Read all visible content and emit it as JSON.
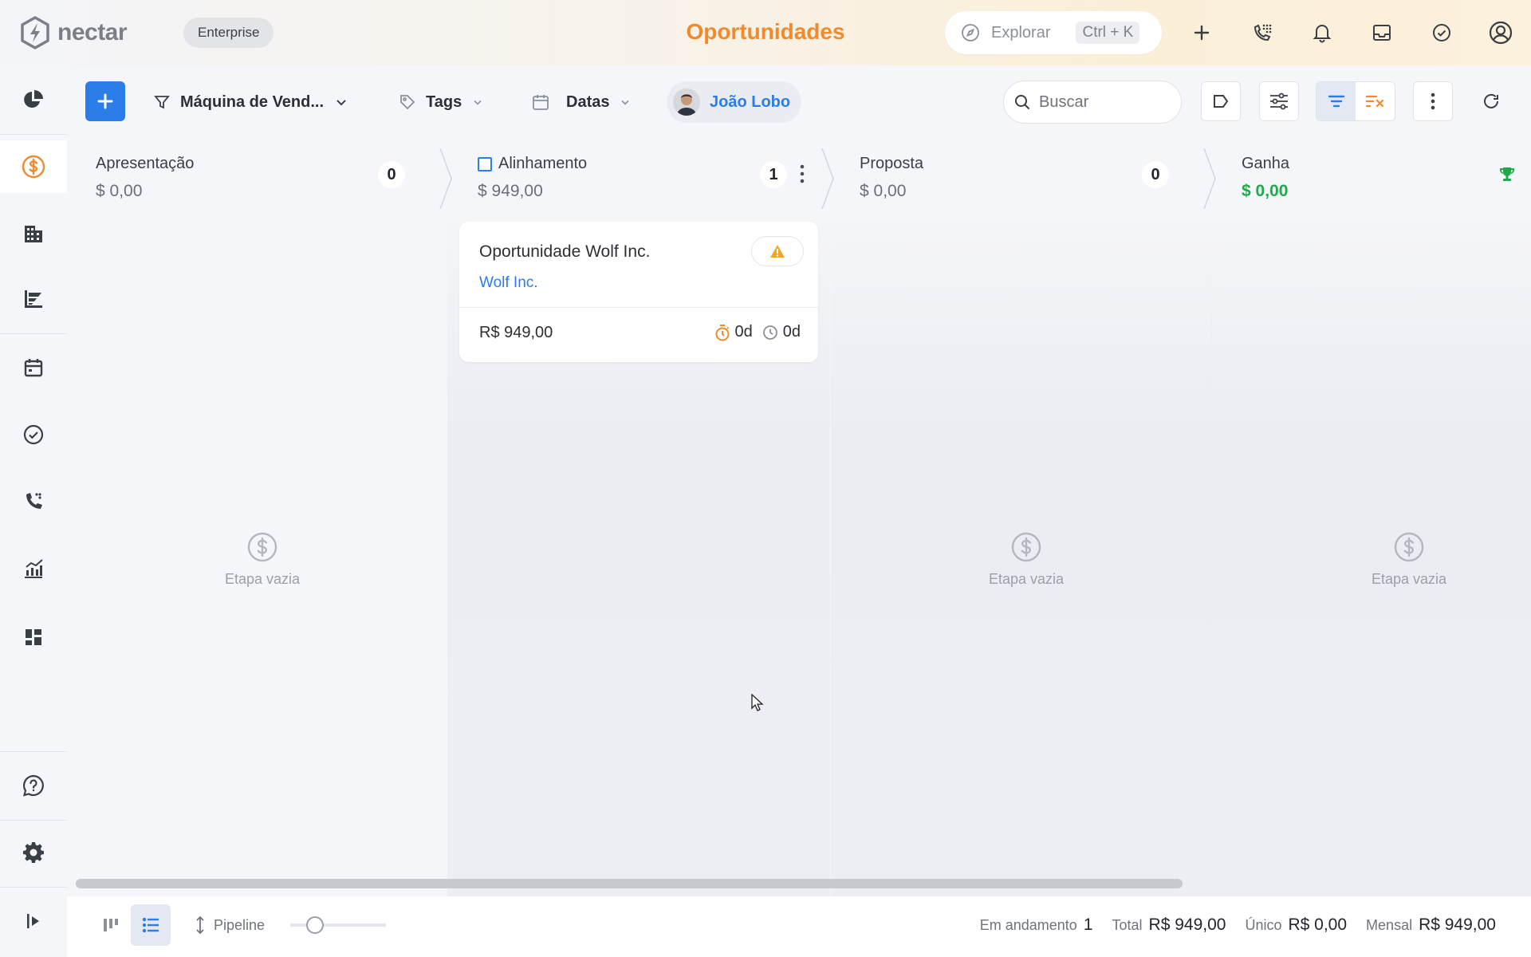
{
  "brand": {
    "name": "nectar",
    "plan": "Enterprise"
  },
  "page_title": "Oportunidades",
  "explore": {
    "label": "Explorar",
    "shortcut": "Ctrl + K"
  },
  "top_icons": [
    "plus-icon",
    "phone-dialpad-icon",
    "bell-icon",
    "inbox-icon",
    "check-circle-icon",
    "user-circle-icon"
  ],
  "sidebar": {
    "items": [
      {
        "name": "dashboard",
        "icon": "pie-chart-icon"
      },
      {
        "name": "opportunities",
        "icon": "dollar-circle-icon",
        "active": true
      },
      {
        "name": "companies",
        "icon": "building-icon"
      },
      {
        "name": "funnel",
        "icon": "funnel-chart-icon"
      },
      {
        "name": "calendar",
        "icon": "calendar-icon"
      },
      {
        "name": "tasks",
        "icon": "check-circle-icon"
      },
      {
        "name": "calls",
        "icon": "phone-icon"
      },
      {
        "name": "reports",
        "icon": "line-chart-icon"
      },
      {
        "name": "widgets",
        "icon": "dashboard-tiles-icon"
      },
      {
        "name": "help",
        "icon": "help-bubble-icon"
      },
      {
        "name": "settings",
        "icon": "gear-icon"
      },
      {
        "name": "expand",
        "icon": "expand-sidebar-icon"
      }
    ]
  },
  "toolbar": {
    "pipeline": "Máquina de Vend...",
    "tags": "Tags",
    "dates": "Datas",
    "owner": "João Lobo",
    "search_placeholder": "Buscar"
  },
  "stages": [
    {
      "name": "Apresentação",
      "value": "$ 0,00",
      "count": "0",
      "empty_label": "Etapa vazia"
    },
    {
      "name": "Alinhamento",
      "value": "$ 949,00",
      "count": "1"
    },
    {
      "name": "Proposta",
      "value": "$ 0,00",
      "count": "0",
      "empty_label": "Etapa vazia"
    },
    {
      "name": "Ganha",
      "value": "$ 0,00",
      "empty_label": "Etapa vazia"
    }
  ],
  "card": {
    "title": "Oportunidade Wolf Inc.",
    "company": "Wolf Inc.",
    "amount": "R$ 949,00",
    "timer_days": "0d",
    "clock_days": "0d"
  },
  "footer": {
    "pipeline_label": "Pipeline",
    "in_progress_label": "Em andamento",
    "in_progress_value": "1",
    "total_label": "Total",
    "total_value": "R$ 949,00",
    "unique_label": "Único",
    "unique_value": "R$ 0,00",
    "monthly_label": "Mensal",
    "monthly_value": "R$ 949,00"
  },
  "colors": {
    "accent": "#2b7de9",
    "title": "#f08a2e",
    "won": "#1faa4a",
    "warning": "#f5a524"
  }
}
